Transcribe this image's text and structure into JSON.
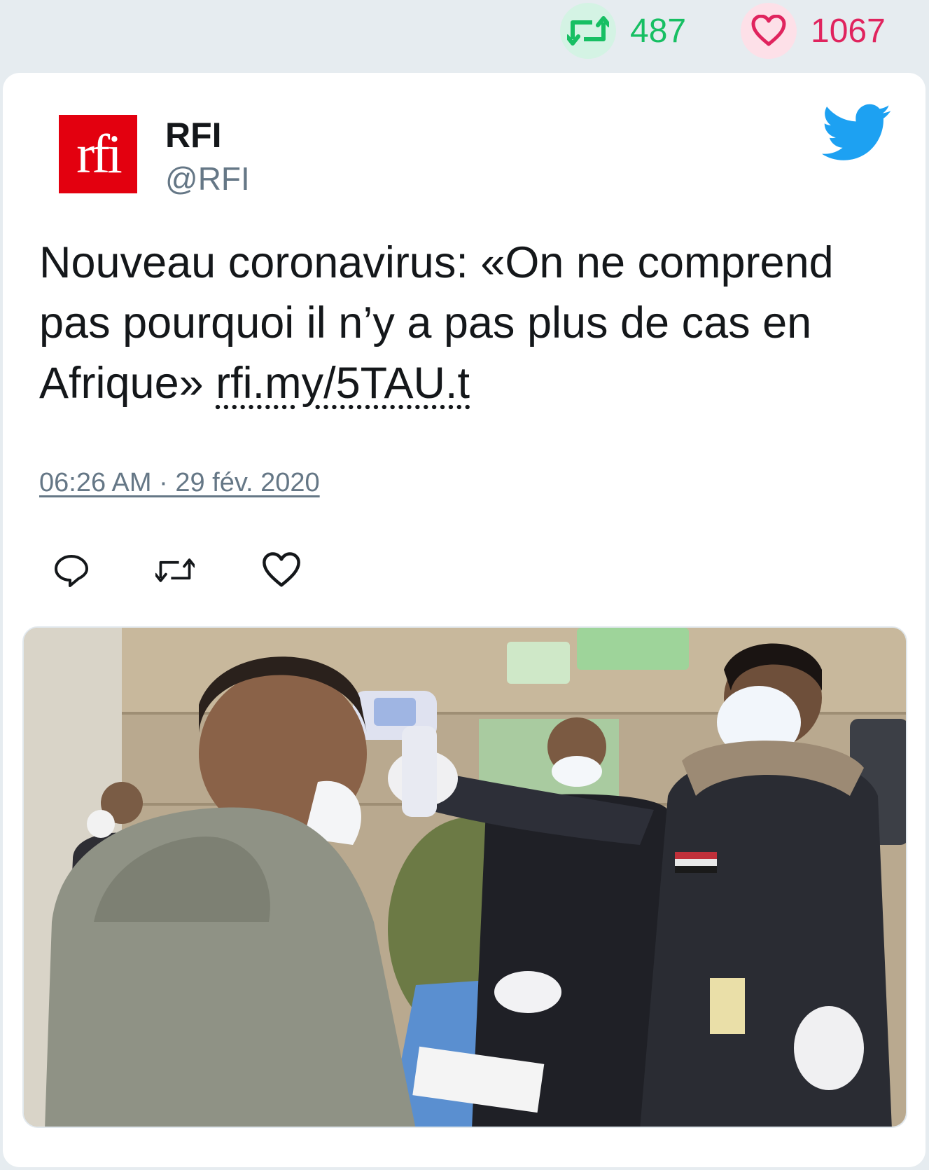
{
  "stats": {
    "retweets": "487",
    "likes": "1067",
    "retweet_color": "#17bf63",
    "like_color": "#e0245e"
  },
  "tweet": {
    "author_name": "RFI",
    "author_handle": "@RFI",
    "avatar_logo_text": "rfi",
    "text": "Nouveau coronavirus: «On ne comprend pas pourquoi il n’y a pas plus de cas en Afrique» ",
    "link": "rfi.my/5TAU.t",
    "timestamp": "06:26 AM · 29 fév. 2020",
    "brand_color": "#1da1f2"
  },
  "icons": {
    "retweet": "retweet-icon",
    "like": "heart-icon",
    "reply": "reply-icon",
    "brand": "twitter-bird-icon"
  }
}
